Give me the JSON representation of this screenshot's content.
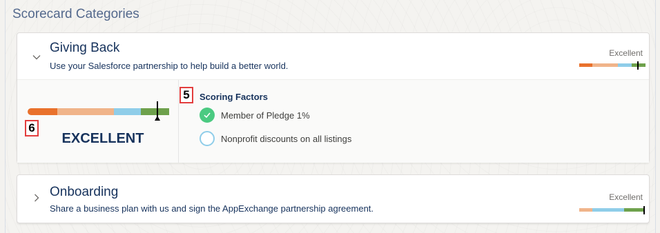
{
  "section": {
    "title": "Scorecard Categories"
  },
  "categories": [
    {
      "title": "Giving Back",
      "description": "Use your Salesforce partnership to help build a better world.",
      "mini_label": "Excellent",
      "expanded": true,
      "rating": "EXCELLENT",
      "scoring_factors_title": "Scoring Factors",
      "factors": [
        {
          "label": "Member of Pledge 1%",
          "status": "complete"
        },
        {
          "label": "Nonprofit discounts on all listings",
          "status": "incomplete"
        }
      ],
      "callouts": {
        "score": "6",
        "factors": "5"
      }
    },
    {
      "title": "Onboarding",
      "description": "Share a business plan with us and sign the AppExchange partnership agreement.",
      "mini_label": "Excellent",
      "expanded": false
    }
  ],
  "colors": {
    "poor": "#e9712c",
    "fair": "#f0b48a",
    "good": "#8fcde9",
    "excellent": "#6ea14c",
    "check": "#4bca81",
    "text": "#16325c"
  },
  "icons": {
    "expanded": "chevron-down-icon",
    "collapsed": "chevron-right-icon",
    "complete": "check-icon",
    "incomplete": "circle-outline-icon"
  }
}
